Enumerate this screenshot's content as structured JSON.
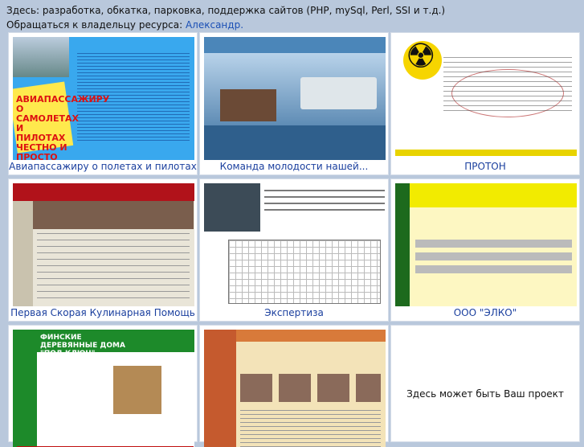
{
  "header": {
    "line1": "Здесь: разработка, обкатка, парковка, поддержка сайтов (PHP, mySql, Perl, SSI и т.д.)",
    "line2_prefix": "Обращаться к владельцу ресурса: ",
    "owner_link": "Александр."
  },
  "projects": [
    {
      "caption": "Авиапассажиру о полетах и пилотах",
      "thumb_text": "АВИАПАССАЖИРУ О САМОЛЕТАХ И ПИЛОТАХ ЧЕСТНО И ПРОСТО"
    },
    {
      "caption": "Команда молодости нашей..."
    },
    {
      "caption": "ПРОТОН"
    },
    {
      "caption": "Первая Скорая Кулинарная Помощь"
    },
    {
      "caption": "Экспертиза"
    },
    {
      "caption": "ООО \"ЭЛКО\""
    },
    {
      "caption": "",
      "thumb_text": "ФИНСКИЕ ДЕРЕВЯННЫЕ ДОМА \"ПОД КЛЮЧ\""
    },
    {
      "caption": ""
    }
  ],
  "placeholder": {
    "text": "Здесь может быть Ваш проект"
  },
  "colors": {
    "background": "#b9c8dc",
    "link": "#1a3f9e"
  }
}
